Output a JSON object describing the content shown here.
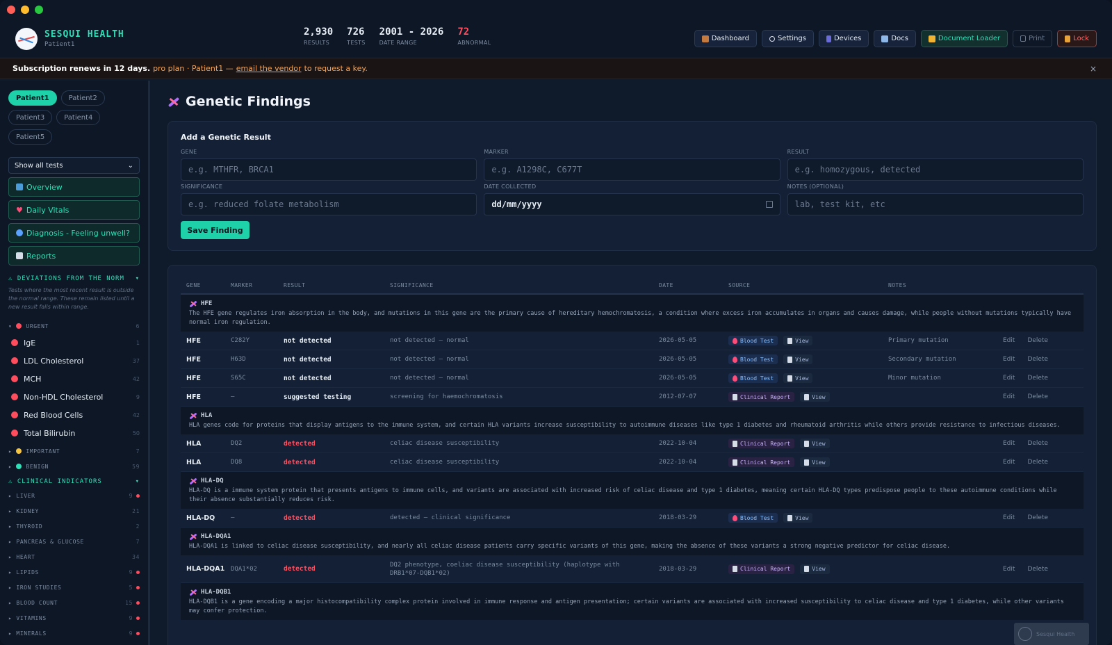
{
  "app": {
    "name": "SESQUI HEALTH",
    "patient": "Patient1"
  },
  "stats": [
    {
      "value": "2,930",
      "label": "RESULTS"
    },
    {
      "value": "726",
      "label": "TESTS"
    },
    {
      "value": "2001 - 2026",
      "label": "DATE RANGE"
    },
    {
      "value": "72",
      "label": "ABNORMAL"
    }
  ],
  "nav": {
    "dashboard": "Dashboard",
    "settings": "Settings",
    "devices": "Devices",
    "docs": "Docs",
    "document_loader": "Document Loader",
    "print": "Print",
    "lock": "Lock"
  },
  "banner": {
    "bold": "Subscription renews in 12 days.",
    "text": "pro plan · Patient1 —",
    "link": "email the vendor",
    "suffix": "to request a key.",
    "close": "×"
  },
  "sidebar": {
    "patients": [
      "Patient1",
      "Patient2",
      "Patient3",
      "Patient4",
      "Patient5"
    ],
    "filter": "Show all tests",
    "links": {
      "overview": "Overview",
      "vitals": "Daily Vitals",
      "diagnosis": "Diagnosis - Feeling unwell?",
      "reports": "Reports"
    },
    "deviations": {
      "title": "DEVIATIONS FROM THE NORM",
      "note": "Tests where the most recent result is outside the normal range. These remain listed until a new result falls within range.",
      "urgent_label": "URGENT",
      "urgent_count": "6",
      "urgent_tests": [
        {
          "name": "IgE",
          "count": "1"
        },
        {
          "name": "LDL Cholesterol",
          "count": "37"
        },
        {
          "name": "MCH",
          "count": "42"
        },
        {
          "name": "Non-HDL Cholesterol",
          "count": "9"
        },
        {
          "name": "Red Blood Cells",
          "count": "42"
        },
        {
          "name": "Total Bilirubin",
          "count": "50"
        }
      ],
      "important_label": "IMPORTANT",
      "important_count": "7",
      "benign_label": "BENIGN",
      "benign_count": "59"
    },
    "clinical": {
      "title": "CLINICAL INDICATORS",
      "items": [
        {
          "name": "LIVER",
          "count": "9"
        },
        {
          "name": "KIDNEY",
          "count": "21"
        },
        {
          "name": "THYROID",
          "count": "2"
        },
        {
          "name": "PANCREAS & GLUCOSE",
          "count": "7"
        },
        {
          "name": "HEART",
          "count": "34"
        },
        {
          "name": "LIPIDS",
          "count": "9"
        },
        {
          "name": "IRON STUDIES",
          "count": "5"
        },
        {
          "name": "BLOOD COUNT",
          "count": "15"
        },
        {
          "name": "VITAMINS",
          "count": "9"
        },
        {
          "name": "MINERALS",
          "count": "9"
        }
      ]
    }
  },
  "main": {
    "title": "Genetic Findings",
    "form": {
      "title": "Add a Genetic Result",
      "gene_label": "GENE",
      "gene_placeholder": "e.g. MTHFR, BRCA1",
      "marker_label": "MARKER",
      "marker_placeholder": "e.g. A1298C, C677T",
      "result_label": "RESULT",
      "result_placeholder": "e.g. homozygous, detected",
      "significance_label": "SIGNIFICANCE",
      "significance_placeholder": "e.g. reduced folate metabolism",
      "date_label": "DATE COLLECTED",
      "date_value": "dd/mm/yyyy",
      "notes_label": "NOTES (OPTIONAL)",
      "notes_placeholder": "lab, test kit, etc",
      "save": "Save Finding"
    },
    "table": {
      "headers": [
        "GENE",
        "MARKER",
        "RESULT",
        "SIGNIFICANCE",
        "DATE",
        "SOURCE",
        "NOTES"
      ],
      "edit": "Edit",
      "delete": "Delete",
      "view": "View",
      "groups": [
        {
          "name": "HFE",
          "desc": "The HFE gene regulates iron absorption in the body, and mutations in this gene are the primary cause of hereditary hemochromatosis, a condition where excess iron accumulates in organs and causes damage, while people without mutations typically have normal iron regulation.",
          "rows": [
            {
              "gene": "HFE",
              "marker": "C282Y",
              "result": "not detected",
              "sig": "not detected — normal",
              "date": "2026-05-05",
              "source": "Blood Test",
              "notes": "Primary mutation"
            },
            {
              "gene": "HFE",
              "marker": "H63D",
              "result": "not detected",
              "sig": "not detected — normal",
              "date": "2026-05-05",
              "source": "Blood Test",
              "notes": "Secondary mutation"
            },
            {
              "gene": "HFE",
              "marker": "S65C",
              "result": "not detected",
              "sig": "not detected — normal",
              "date": "2026-05-05",
              "source": "Blood Test",
              "notes": "Minor mutation"
            },
            {
              "gene": "HFE",
              "marker": "—",
              "result": "suggested testing",
              "sig": "screening for haemochromatosis",
              "date": "2012-07-07",
              "source": "Clinical Report",
              "notes": ""
            }
          ]
        },
        {
          "name": "HLA",
          "desc": "HLA genes code for proteins that display antigens to the immune system, and certain HLA variants increase susceptibility to autoimmune diseases like type 1 diabetes and rheumatoid arthritis while others provide resistance to infectious diseases.",
          "rows": [
            {
              "gene": "HLA",
              "marker": "DQ2",
              "result": "detected",
              "sig": "celiac disease susceptibility",
              "date": "2022-10-04",
              "source": "Clinical Report",
              "notes": ""
            },
            {
              "gene": "HLA",
              "marker": "DQ8",
              "result": "detected",
              "sig": "celiac disease susceptibility",
              "date": "2022-10-04",
              "source": "Clinical Report",
              "notes": ""
            }
          ]
        },
        {
          "name": "HLA-DQ",
          "desc": "HLA-DQ is a immune system protein that presents antigens to immune cells, and variants are associated with increased risk of celiac disease and type 1 diabetes, meaning certain HLA-DQ types predispose people to these autoimmune conditions while their absence substantially reduces risk.",
          "rows": [
            {
              "gene": "HLA-DQ",
              "marker": "—",
              "result": "detected",
              "sig": "detected — clinical significance",
              "date": "2018-03-29",
              "source": "Blood Test",
              "notes": ""
            }
          ]
        },
        {
          "name": "HLA-DQA1",
          "desc": "HLA-DQA1 is linked to celiac disease susceptibility, and nearly all celiac disease patients carry specific variants of this gene, making the absence of these variants a strong negative predictor for celiac disease.",
          "rows": [
            {
              "gene": "HLA-DQA1",
              "marker": "DQA1*02",
              "result": "detected",
              "sig": "DQ2 phenotype, coeliac disease susceptibility (haplotype with DRB1*07-DQB1*02)",
              "date": "2018-03-29",
              "source": "Clinical Report",
              "notes": ""
            }
          ]
        },
        {
          "name": "HLA-DQB1",
          "desc": "HLA-DQB1 is a gene encoding a major histocompatibility complex protein involved in immune response and antigen presentation; certain variants are associated with increased susceptibility to celiac disease and type 1 diabetes, while other variants may confer protection.",
          "rows": []
        }
      ]
    },
    "watermark": "Sesqui Health"
  }
}
